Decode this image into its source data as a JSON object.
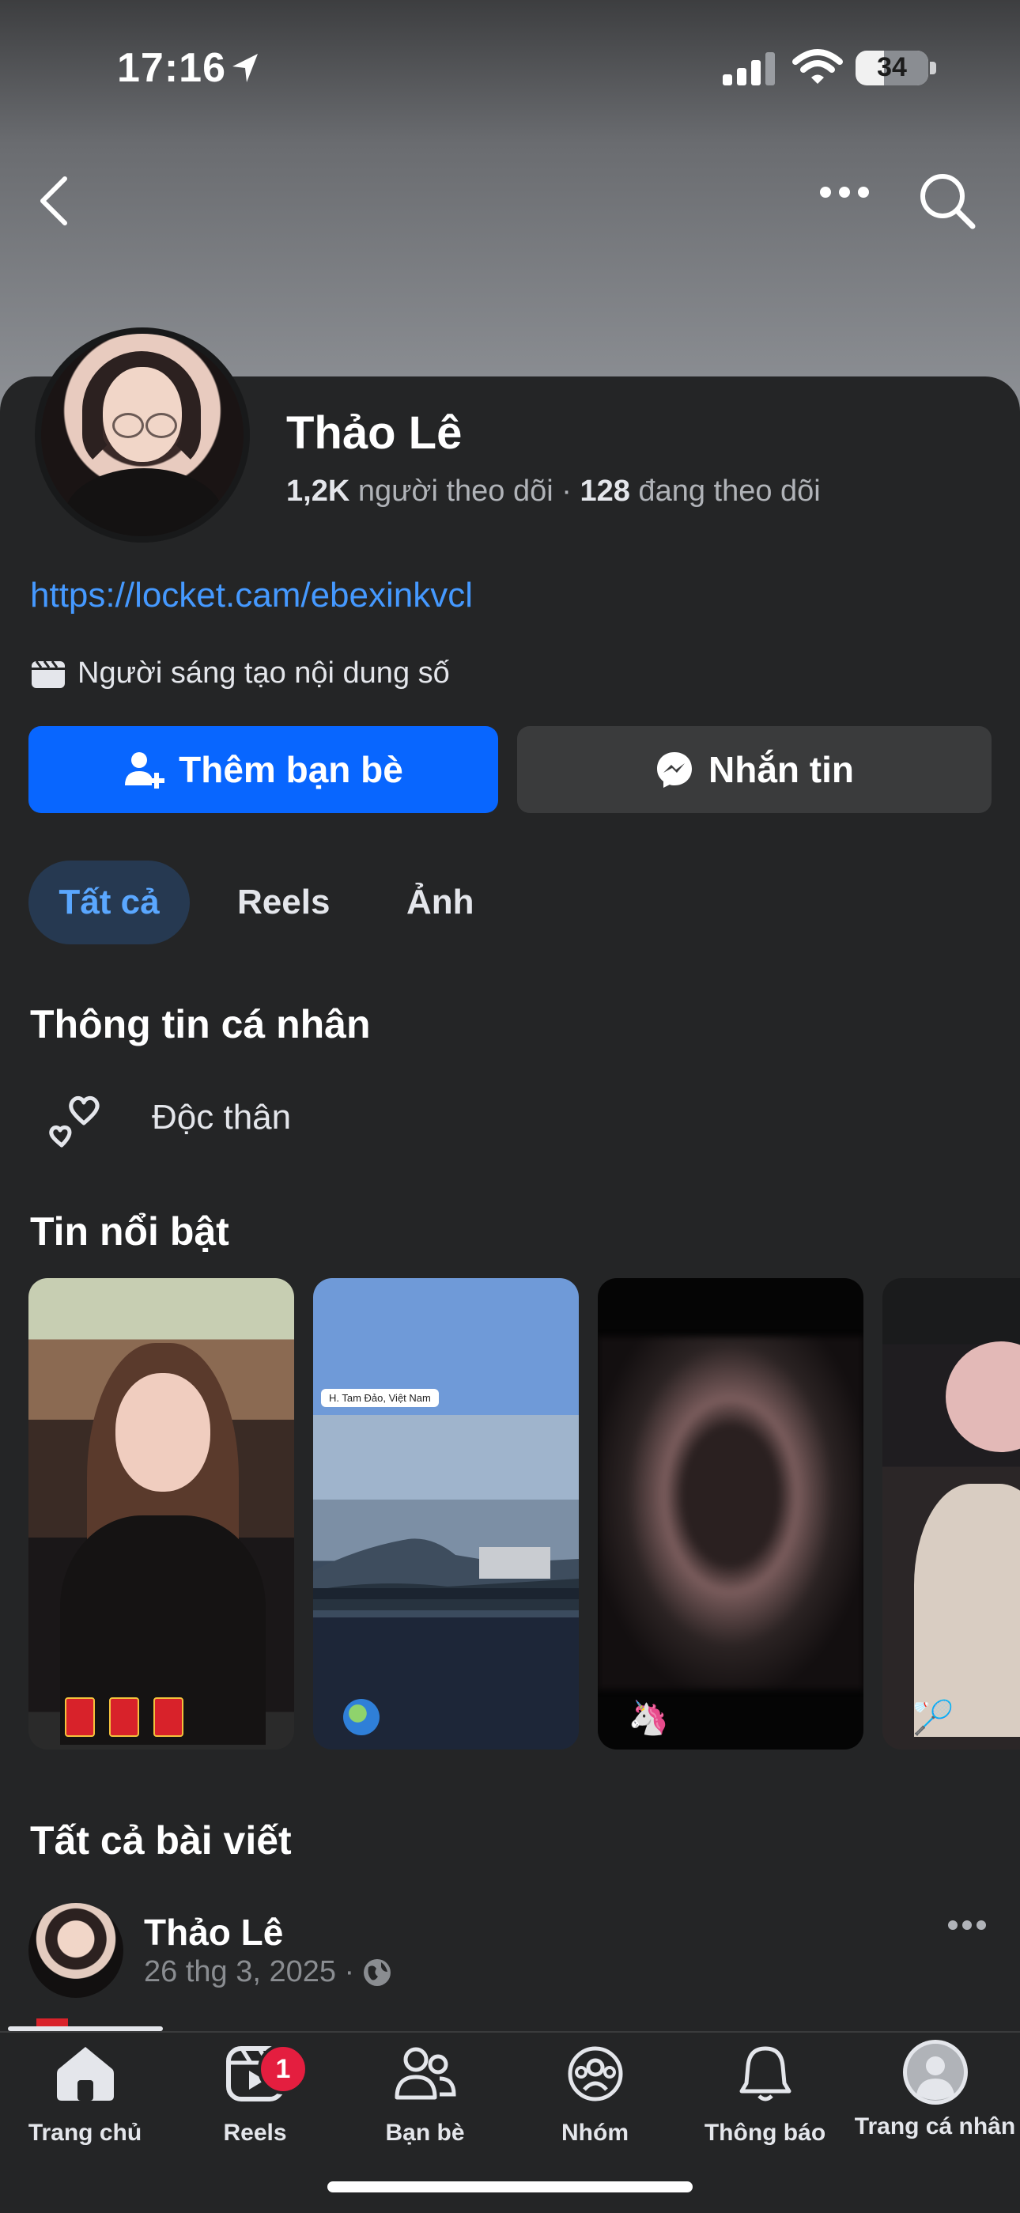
{
  "status_bar": {
    "time": "17:16",
    "battery": "34"
  },
  "profile": {
    "name": "Thảo Lê",
    "followers_count": "1,2K",
    "followers_label": " người theo dõi · ",
    "following_count": "128",
    "following_label": " đang theo dõi",
    "link": "https://locket.cam/ebexinkvcl",
    "category": "Người sáng tạo nội dung số"
  },
  "actions": {
    "add_friend": "Thêm bạn bè",
    "message": "Nhắn tin"
  },
  "tabs": [
    {
      "label": "Tất cả",
      "active": true
    },
    {
      "label": "Reels"
    },
    {
      "label": "Ảnh"
    }
  ],
  "personal_info": {
    "title": "Thông tin cá nhân",
    "relationship": "Độc thân"
  },
  "highlights": {
    "title": "Tin nổi bật",
    "location_tag": "H. Tam Đảo, Việt Nam"
  },
  "posts": {
    "title": "Tất cả bài viết",
    "first_post": {
      "author": "Thảo Lê",
      "date": "26 thg 3, 2025 ·"
    }
  },
  "bottom_nav": [
    {
      "label": "Trang chủ",
      "icon": "home-icon",
      "active": true
    },
    {
      "label": "Reels",
      "icon": "reels-icon",
      "badge": "1"
    },
    {
      "label": "Bạn bè",
      "icon": "friends-icon"
    },
    {
      "label": "Nhóm",
      "icon": "groups-icon"
    },
    {
      "label": "Thông báo",
      "icon": "bell-icon"
    },
    {
      "label": "Trang cá nhân",
      "icon": "profile-icon"
    }
  ],
  "colors": {
    "accent": "#0866ff",
    "link": "#4599ff",
    "background": "#242526",
    "badge": "#e41e3f"
  }
}
